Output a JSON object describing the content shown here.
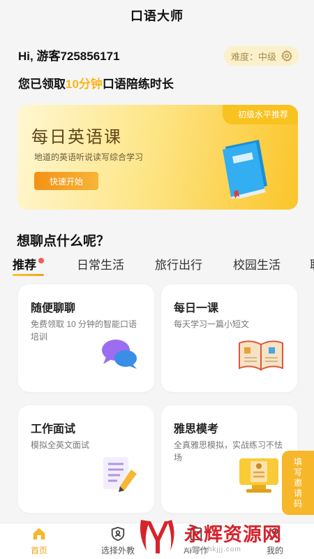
{
  "app": {
    "title": "口语大师"
  },
  "header": {
    "greeting": "Hi, 游客725856171",
    "level_label": "难度：中级",
    "claim_prefix": "您已领取",
    "claim_highlight": "10分钟",
    "claim_suffix": "口语陪练时长",
    "highlight_color": "#f6b71b"
  },
  "banner": {
    "tag": "初级水平推荐",
    "title": "每日英语课",
    "subtitle": "地道的英语听说读写综合学习",
    "button": "快速开始"
  },
  "section": {
    "title": "想聊点什么呢？"
  },
  "tabs": [
    {
      "label": "推荐",
      "active": true
    },
    {
      "label": "日常生活"
    },
    {
      "label": "旅行出行"
    },
    {
      "label": "校园生活"
    },
    {
      "label": "职"
    }
  ],
  "cards": [
    {
      "title": "随便聊聊",
      "desc": "免费领取 10 分钟的智能口语培训",
      "icon": "chat-bubbles-icon"
    },
    {
      "title": "每日一课",
      "desc": "每天学习一篇小短文",
      "icon": "open-book-icon"
    },
    {
      "title": "工作面试",
      "desc": "模拟全英文面试",
      "icon": "document-pencil-icon"
    },
    {
      "title": "雅思模考",
      "desc": "全真雅思模拟，实战练习不怯场",
      "icon": "monitor-exam-icon"
    }
  ],
  "invite": {
    "label": "填写邀请码"
  },
  "nav": [
    {
      "label": "首页",
      "icon": "home-icon",
      "active": true
    },
    {
      "label": "选择外教",
      "icon": "teacher-icon"
    },
    {
      "label": "AI写作",
      "icon": "ai-write-icon"
    },
    {
      "label": "我的",
      "icon": "profile-icon"
    }
  ],
  "watermark": {
    "text": "永辉资源网",
    "url": "www.yhkjjj.com"
  },
  "colors": {
    "accent": "#f7b72b",
    "active_nav": "#f0a415"
  }
}
